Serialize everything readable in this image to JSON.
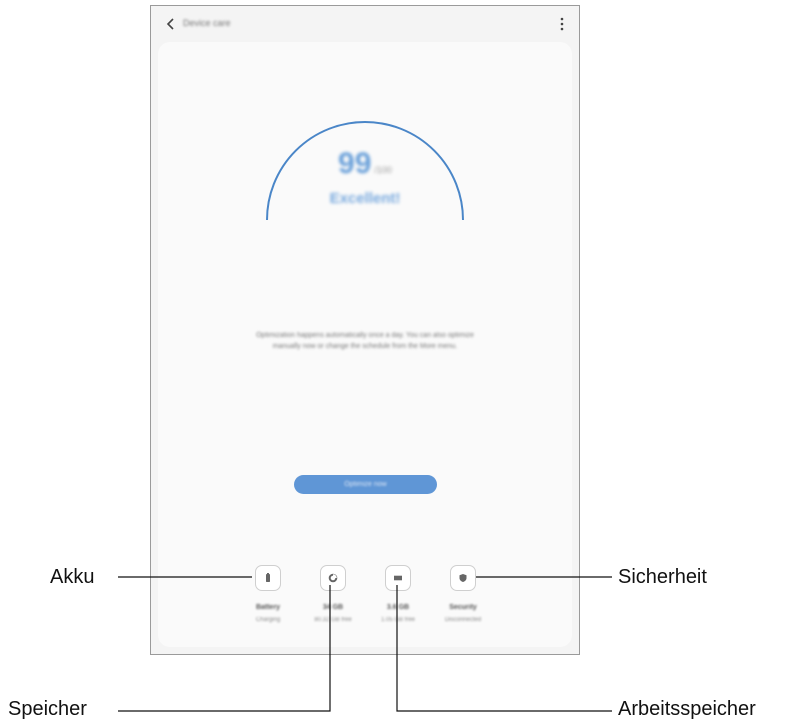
{
  "appbar": {
    "title": "Device care"
  },
  "score": {
    "value": "99",
    "max": "/100",
    "status": "Excellent!"
  },
  "message": "Optimization happens automatically once a day. You can also optimize manually now or change the schedule from the More menu.",
  "optimize_button": "Optimize now",
  "tiles": [
    {
      "name": "Battery",
      "status": "Charging"
    },
    {
      "name": "34 GB",
      "status": "80.32 GB free"
    },
    {
      "name": "3.6 GB",
      "status": "1.05 GB free"
    },
    {
      "name": "Security",
      "status": "Disconnected"
    }
  ],
  "callouts": {
    "akku": "Akku",
    "speicher": "Speicher",
    "sicherheit": "Sicherheit",
    "arbeitsspeicher": "Arbeitsspeicher"
  },
  "colors": {
    "accent": "#5f96d6",
    "gauge": "#4a86c8",
    "background": "#f4f4f4"
  }
}
